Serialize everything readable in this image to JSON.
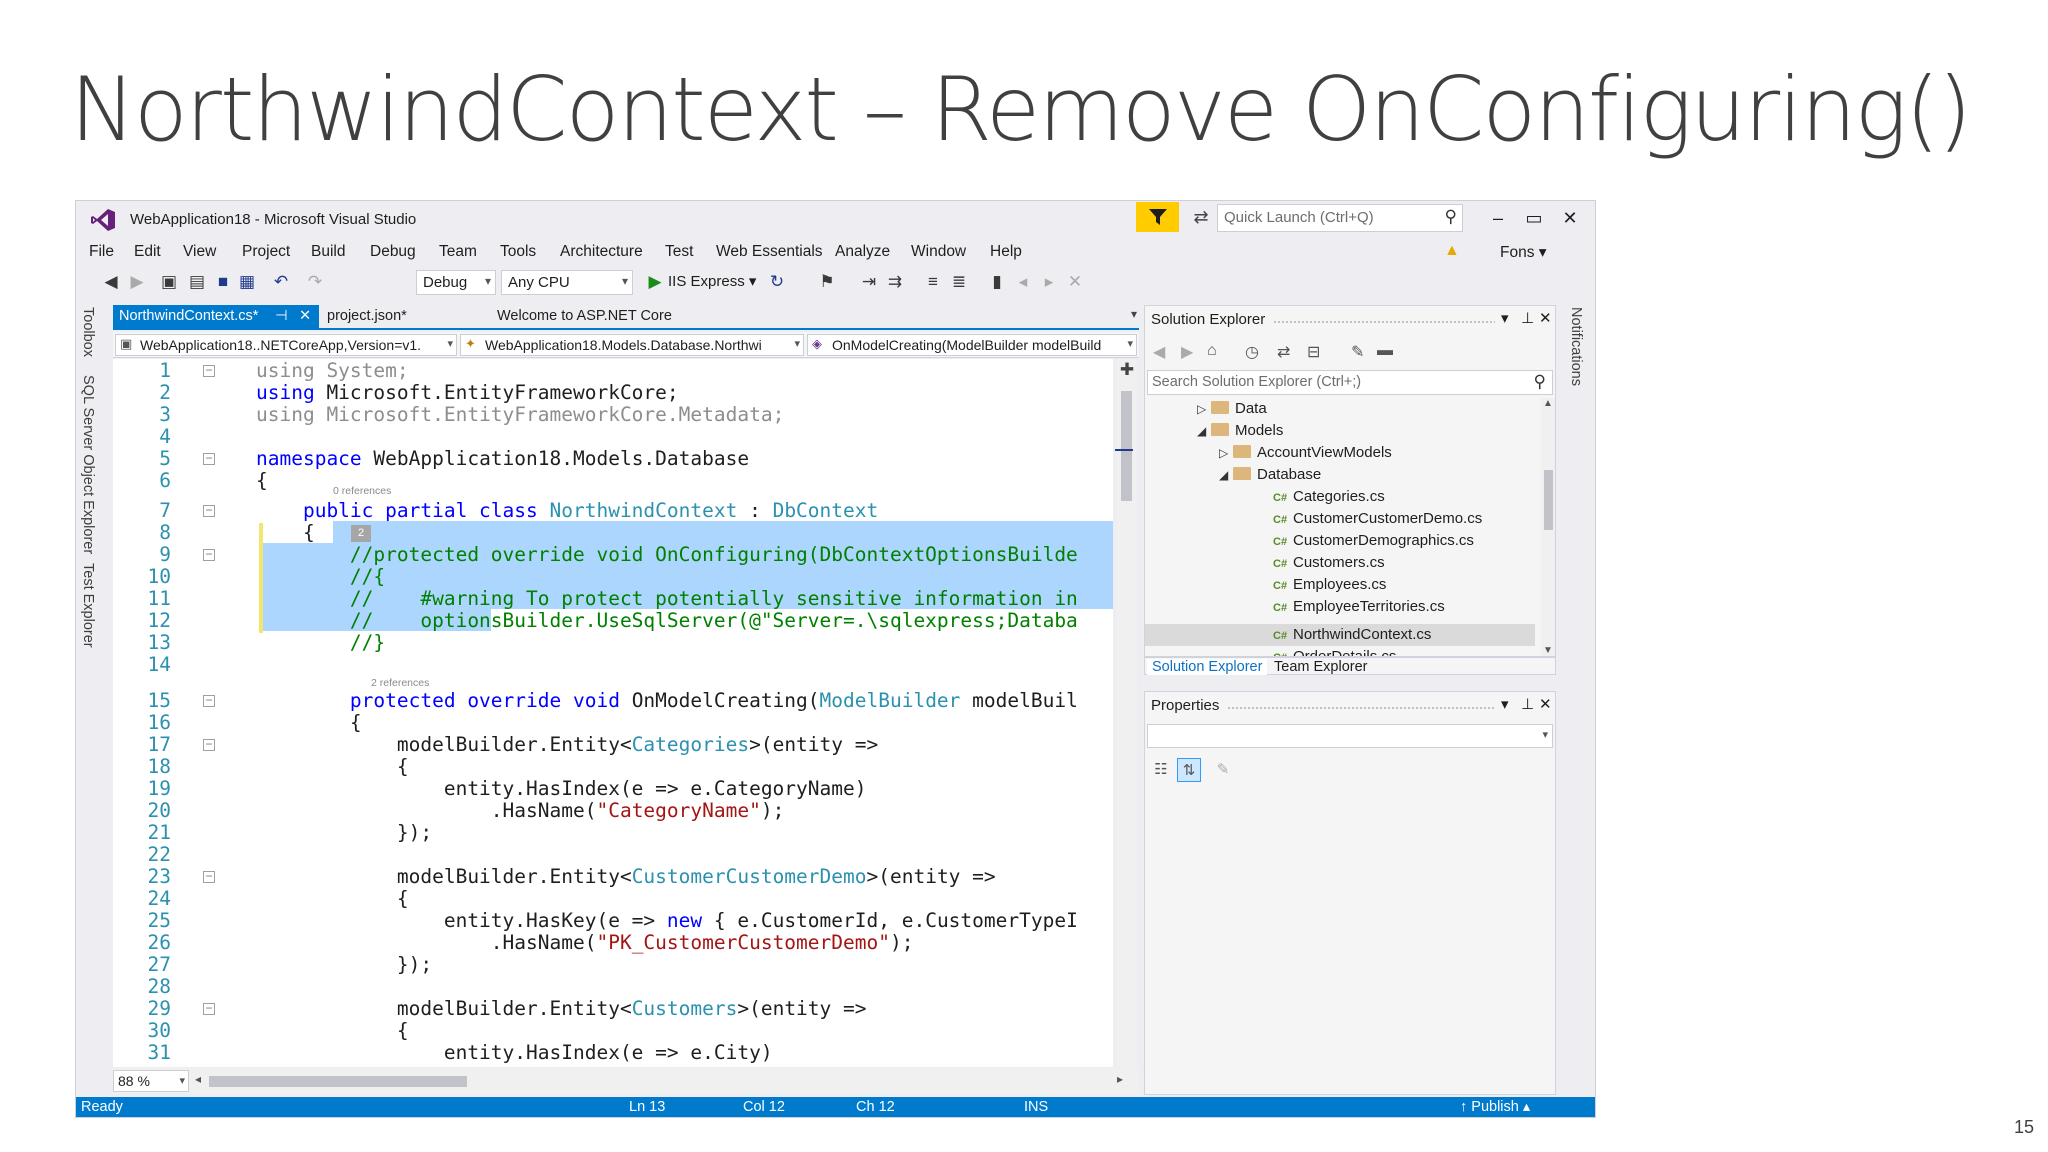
{
  "slide": {
    "title": "NorthwindContext – Remove OnConfiguring()",
    "page_number": "15"
  },
  "window": {
    "title": "WebApplication18 - Microsoft Visual Studio",
    "quick_launch_placeholder": "Quick Launch (Ctrl+Q)",
    "user": "Fons"
  },
  "menu": [
    "File",
    "Edit",
    "View",
    "Project",
    "Build",
    "Debug",
    "Team",
    "Tools",
    "Architecture",
    "Test",
    "Web Essentials",
    "Analyze",
    "Window",
    "Help"
  ],
  "toolbar": {
    "configuration": "Debug",
    "platform": "Any CPU",
    "run_target": "IIS Express"
  },
  "left_rail": [
    "Toolbox",
    "SQL Server Object Explorer",
    "Test Explorer"
  ],
  "right_rail": [
    "Notifications"
  ],
  "editor": {
    "tabs": [
      {
        "label": "NorthwindContext.cs*",
        "active": true
      },
      {
        "label": "project.json*",
        "active": false
      },
      {
        "label": "Welcome to ASP.NET Core",
        "active": false
      }
    ],
    "nav": {
      "project": "WebApplication18..NETCoreApp,Version=v1.",
      "type": "WebApplication18.Models.Database.Northwi",
      "member": "OnModelCreating(ModelBuilder modelBuild"
    },
    "code_lens": {
      "line7": "0 references",
      "line7_badge": "2",
      "line15": "2 references"
    },
    "line_numbers": [
      "1",
      "2",
      "3",
      "4",
      "5",
      "6",
      "7",
      "8",
      "9",
      "10",
      "11",
      "12",
      "13",
      "14",
      "15",
      "16",
      "17",
      "18",
      "19",
      "20",
      "21",
      "22",
      "23",
      "24",
      "25",
      "26",
      "27",
      "28",
      "29",
      "30",
      "31"
    ],
    "code": {
      "l1a": "using",
      "l1b": " System;",
      "l2a": "using",
      "l2b": " Microsoft.EntityFrameworkCore;",
      "l3a": "using",
      "l3b": " Microsoft.EntityFrameworkCore.Metadata;",
      "l5a": "namespace",
      "l5b": " WebApplication18.Models.Database",
      "l6": "{",
      "l7a": "    public partial class ",
      "l7b": "NorthwindContext",
      "l7c": " : ",
      "l7d": "DbContext",
      "l8": "    {",
      "l9": "        //protected override void OnConfiguring(DbContextOptionsBuilde",
      "l10": "        //{",
      "l11": "        //    #warning To protect potentially sensitive information in",
      "l12": "        //    optionsBuilder.UseSqlServer(@\"Server=.\\sqlexpress;Databa",
      "l13": "        //}",
      "l15a": "        protected override void ",
      "l15b": "OnModelCreating(",
      "l15c": "ModelBuilder",
      "l15d": " modelBuil",
      "l16": "        {",
      "l17a": "            modelBuilder.Entity<",
      "l17b": "Categories",
      "l17c": ">(entity =>",
      "l18": "            {",
      "l19": "                entity.HasIndex(e => e.CategoryName)",
      "l20a": "                    .HasName(",
      "l20b": "\"CategoryName\"",
      "l20c": ");",
      "l21": "            });",
      "l23a": "            modelBuilder.Entity<",
      "l23b": "CustomerCustomerDemo",
      "l23c": ">(entity =>",
      "l24": "            {",
      "l25a": "                entity.HasKey(e => ",
      "l25b": "new",
      "l25c": " { e.CustomerId, e.CustomerTypeI",
      "l26a": "                    .HasName(",
      "l26b": "\"PK_CustomerCustomerDemo\"",
      "l26c": ");",
      "l27": "            });",
      "l29a": "            modelBuilder.Entity<",
      "l29b": "Customers",
      "l29c": ">(entity =>",
      "l30": "            {",
      "l31": "                entity.HasIndex(e => e.City)"
    },
    "zoom": "88 %"
  },
  "solution_explorer": {
    "title": "Solution Explorer",
    "search_placeholder": "Search Solution Explorer (Ctrl+;)",
    "tree": [
      {
        "label": "Data",
        "kind": "folder",
        "expanded": false
      },
      {
        "label": "Models",
        "kind": "folder",
        "expanded": true
      },
      {
        "label": "AccountViewModels",
        "kind": "folder",
        "expanded": false
      },
      {
        "label": "Database",
        "kind": "folder",
        "expanded": true
      },
      {
        "label": "Categories.cs",
        "kind": "file"
      },
      {
        "label": "CustomerCustomerDemo.cs",
        "kind": "file"
      },
      {
        "label": "CustomerDemographics.cs",
        "kind": "file"
      },
      {
        "label": "Customers.cs",
        "kind": "file"
      },
      {
        "label": "Employees.cs",
        "kind": "file"
      },
      {
        "label": "EmployeeTerritories.cs",
        "kind": "file"
      },
      {
        "label": "NorthwindContext.cs",
        "kind": "file",
        "selected": true
      },
      {
        "label": "OrderDetails.cs",
        "kind": "file"
      }
    ],
    "file_icon": "C#",
    "tabs": [
      "Solution Explorer",
      "Team Explorer"
    ]
  },
  "properties": {
    "title": "Properties"
  },
  "status": {
    "ready": "Ready",
    "line": "Ln 13",
    "col": "Col 12",
    "ch": "Ch 12",
    "mode": "INS",
    "publish": "Publish"
  },
  "colors": {
    "accent": "#007acc",
    "selection": "#add6ff",
    "keyword": "#0000ff",
    "type": "#2b91af",
    "comment": "#008000",
    "string": "#a31515"
  }
}
